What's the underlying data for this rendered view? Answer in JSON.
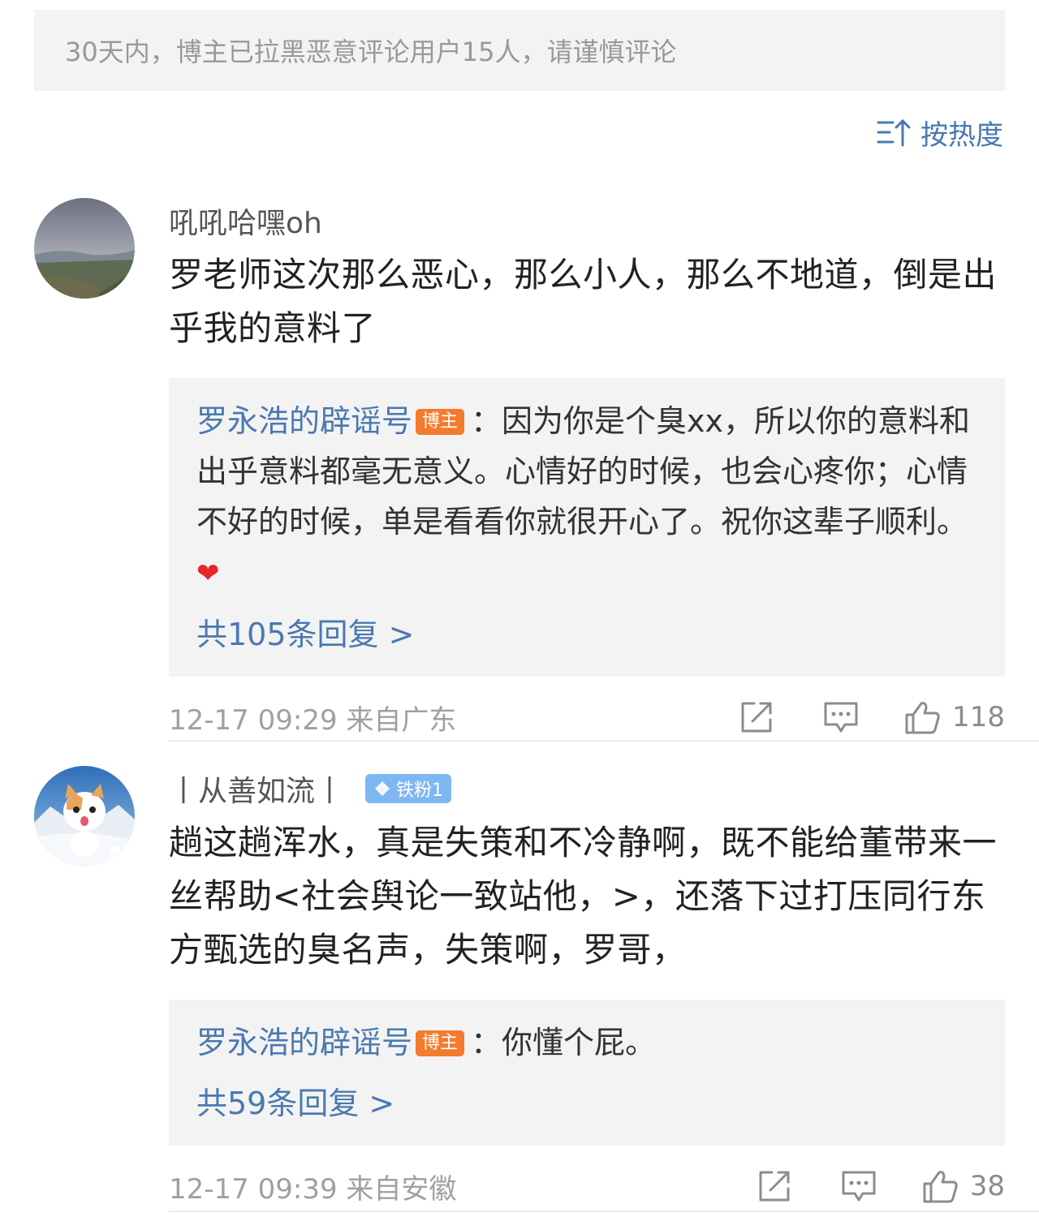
{
  "notice": "30天内，博主已拉黑恶意评论用户15人，请谨慎评论",
  "sort_label": "按热度",
  "colors": {
    "link": "#4a79b0",
    "host_tag": "#f47a2e",
    "fan_badge": "#7fb7f2",
    "heart": "#e8262d"
  },
  "comments": [
    {
      "username": "吼吼哈嘿oh",
      "text": "罗老师这次那么恶心，那么小人，那么不地道，倒是出乎我的意料了",
      "reply": {
        "author": "罗永浩的辟谣号",
        "tag": "博主",
        "text": "：因为你是个臭xx，所以你的意料和出乎意料都毫无意义。心情好的时候，也会心疼你；心情不好的时候，单是看看你就很开心了。祝你这辈子顺利。",
        "emoji": "❤"
      },
      "reply_count": "共105条回复 >",
      "time": "12-17 09:29",
      "location": "来自广东",
      "likes": "118"
    },
    {
      "username": "丨从善如流丨",
      "fan_badge": "铁粉1",
      "text": "趟这趟浑水，真是失策和不冷静啊，既不能给董带来一丝帮助<社会舆论一致站他，>，还落下过打压同行东方甄选的臭名声，失策啊，罗哥，",
      "reply": {
        "author": "罗永浩的辟谣号",
        "tag": "博主",
        "text": "：你懂个屁。"
      },
      "reply_count": "共59条回复 >",
      "time": "12-17 09:39",
      "location": "来自安徽",
      "likes": "38"
    }
  ]
}
